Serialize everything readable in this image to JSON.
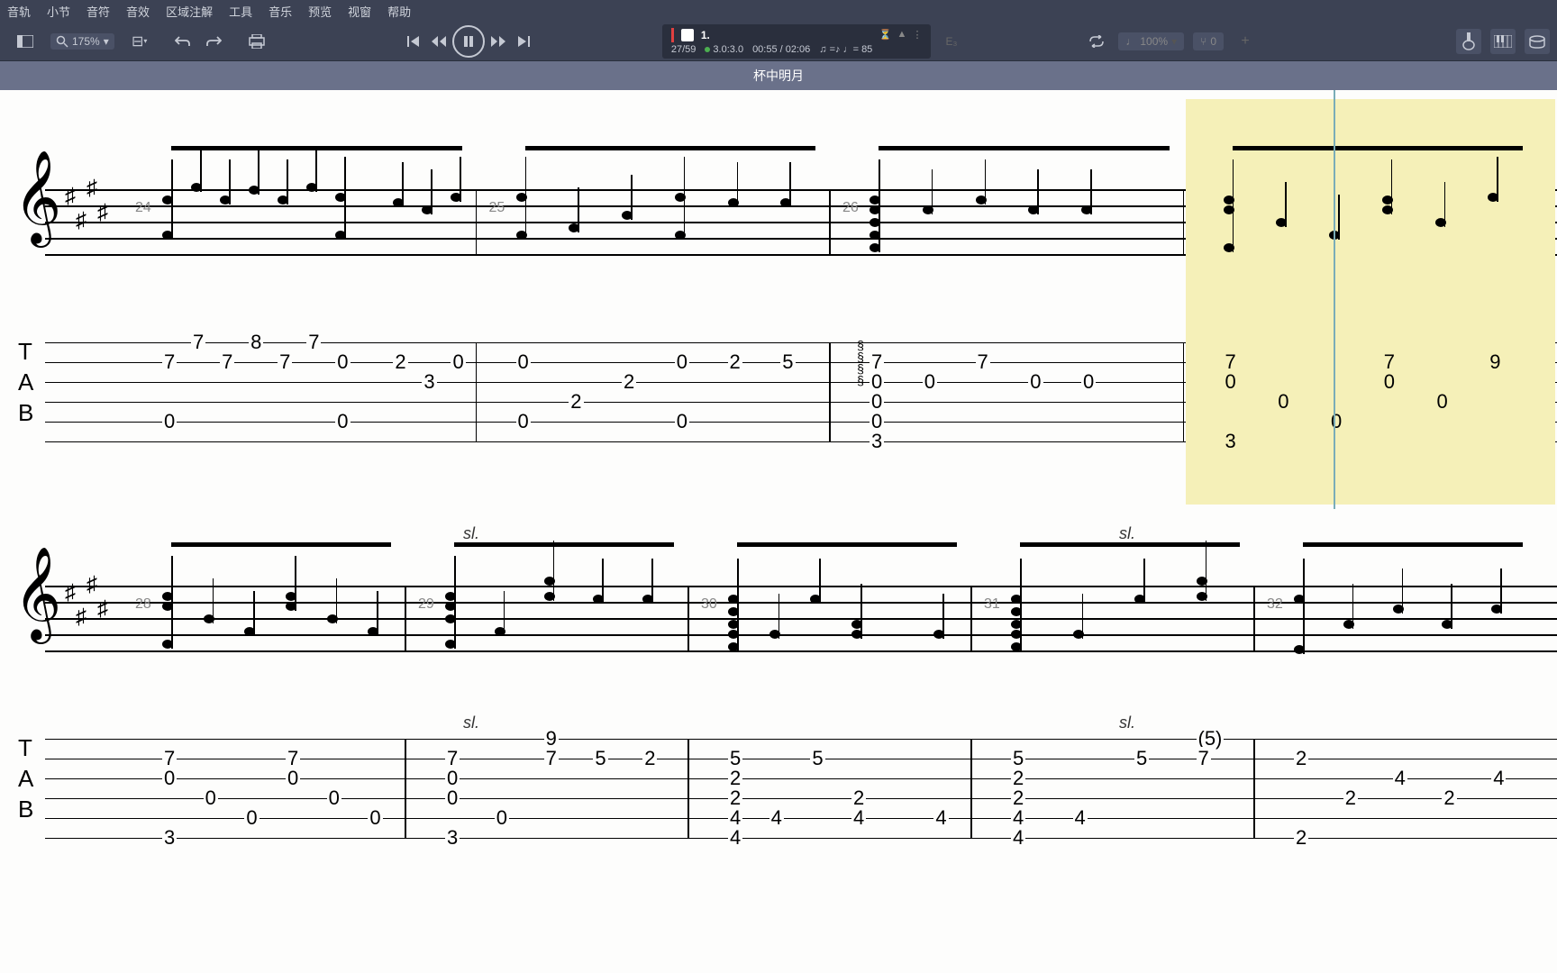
{
  "menu": {
    "items": [
      "音轨",
      "小节",
      "音符",
      "音效",
      "区域注解",
      "工具",
      "音乐",
      "预览",
      "视窗",
      "帮助"
    ]
  },
  "toolbar": {
    "zoom": "175%",
    "track": {
      "name": "1.",
      "bar_pos": "27/59",
      "loop": "3.0:3.0",
      "time": "00:55 / 02:06",
      "tempo": "♫ =♪  ♩= 85"
    },
    "tuning": "E₃",
    "speed": "100%",
    "transpose": "0"
  },
  "title": "杯中明月",
  "systems": [
    {
      "bars": [
        24,
        25,
        26,
        27
      ],
      "highlight_bar": 27,
      "tab": [
        {
          "bar": 24,
          "notes": [
            [
              "",
              "7",
              "",
              "",
              "0",
              ""
            ],
            [
              "7",
              "",
              "",
              "",
              "",
              ""
            ],
            [
              "",
              "7",
              "",
              "",
              "",
              ""
            ],
            [
              "8",
              "",
              "",
              "",
              "",
              ""
            ],
            [
              "",
              "7",
              "",
              "",
              "",
              ""
            ],
            [
              "7",
              "",
              "",
              "",
              "",
              ""
            ],
            [
              "",
              "0",
              "",
              "",
              "0",
              ""
            ],
            [
              "",
              "",
              "",
              "",
              "",
              ""
            ],
            [
              "",
              "2",
              "",
              "",
              "",
              ""
            ],
            [
              "",
              "",
              "3",
              "",
              "",
              ""
            ],
            [
              "",
              "0",
              "",
              "",
              "",
              ""
            ]
          ]
        },
        {
          "bar": 25,
          "notes": [
            [
              "",
              "0",
              "",
              "",
              "0",
              ""
            ],
            [
              "",
              "",
              "",
              "2",
              "",
              ""
            ],
            [
              "",
              "",
              "2",
              "",
              "",
              ""
            ],
            [
              "",
              "0",
              "",
              "",
              "0",
              ""
            ],
            [
              "",
              "2",
              "",
              "",
              "",
              ""
            ],
            [
              "",
              "5",
              "",
              "",
              "",
              ""
            ]
          ]
        },
        {
          "bar": 26,
          "notes": [
            [
              "",
              "7",
              "0",
              "0",
              "0",
              "3"
            ],
            [
              "",
              "",
              "0",
              "",
              "",
              ""
            ],
            [
              "",
              "7",
              "",
              "",
              "",
              ""
            ],
            [
              "",
              "",
              "0",
              "",
              "",
              ""
            ],
            [
              "",
              "",
              "0",
              "",
              "",
              ""
            ],
            [
              "",
              "",
              "",
              "",
              "",
              ""
            ]
          ]
        },
        {
          "bar": 27,
          "notes": [
            [
              "",
              "7",
              "0",
              "",
              "",
              "3"
            ],
            [
              "",
              "",
              "",
              "0",
              "",
              ""
            ],
            [
              "",
              "",
              "",
              "",
              "0",
              ""
            ],
            [
              "",
              "7",
              "0",
              "",
              "",
              ""
            ],
            [
              "",
              "",
              "",
              "0",
              "",
              ""
            ],
            [
              "",
              "9",
              "",
              "",
              "",
              ""
            ]
          ]
        }
      ]
    },
    {
      "bars": [
        28,
        29,
        30,
        31,
        32
      ],
      "slides": [
        {
          "bar": 29,
          "pos": 1
        },
        {
          "bar": 31,
          "pos": 3
        }
      ],
      "tab": [
        {
          "bar": 28,
          "notes": [
            [
              "",
              "7",
              "0",
              "",
              "",
              "3"
            ],
            [
              "",
              "",
              "",
              "0",
              "",
              ""
            ],
            [
              "",
              "",
              "",
              "",
              "0",
              ""
            ],
            [
              "",
              "7",
              "0",
              "",
              "",
              ""
            ],
            [
              "",
              "",
              "",
              "0",
              "",
              ""
            ],
            [
              "",
              "",
              "",
              "",
              "0",
              ""
            ]
          ]
        },
        {
          "bar": 29,
          "notes": [
            [
              "",
              "7",
              "0",
              "0",
              "",
              "3"
            ],
            [
              "",
              "",
              "",
              "",
              "0",
              ""
            ],
            [
              "9",
              "7",
              "",
              "",
              "",
              ""
            ],
            [
              "",
              "5",
              "",
              "",
              "",
              ""
            ],
            [
              "",
              "2",
              "",
              "",
              "",
              ""
            ]
          ]
        },
        {
          "bar": 30,
          "notes": [
            [
              "",
              "5",
              "2",
              "2",
              "4",
              "4"
            ],
            [
              "",
              "",
              "",
              "",
              "4",
              ""
            ],
            [
              "",
              "5",
              "",
              "",
              "",
              ""
            ],
            [
              "",
              "",
              "",
              "2",
              "4",
              ""
            ],
            [
              "",
              "",
              "",
              "",
              "",
              ""
            ],
            [
              "",
              "",
              "",
              "",
              "4",
              ""
            ]
          ]
        },
        {
          "bar": 31,
          "notes": [
            [
              "",
              "5",
              "2",
              "2",
              "4",
              "4"
            ],
            [
              "",
              "",
              "",
              "",
              "4",
              ""
            ],
            [
              "",
              "5",
              "",
              "",
              "",
              ""
            ],
            [
              "(5)",
              "7",
              "",
              "",
              "",
              ""
            ]
          ]
        },
        {
          "bar": 32,
          "notes": [
            [
              "",
              "2",
              "",
              "",
              "",
              "2"
            ],
            [
              "",
              "",
              "",
              "2",
              "",
              ""
            ],
            [
              "",
              "",
              "4",
              "",
              "",
              ""
            ],
            [
              "",
              "",
              "",
              "2",
              "",
              ""
            ],
            [
              "",
              "",
              "4",
              "",
              "",
              ""
            ]
          ]
        }
      ]
    }
  ]
}
